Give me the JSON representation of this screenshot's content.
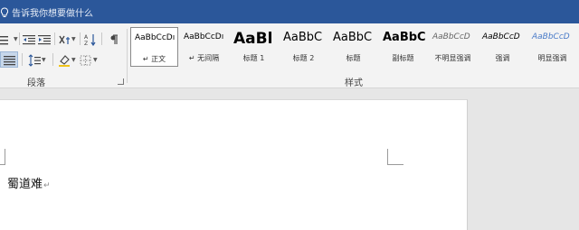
{
  "titlebar": {
    "tell_me": "告诉我你想要做什么",
    "lightbulb_icon": "lightbulb-icon",
    "bg_color": "#2b579a"
  },
  "ribbon": {
    "paragraph_group": {
      "label": "段落",
      "icons": [
        "bullets-icon",
        "decrease-indent-icon",
        "increase-indent-icon",
        "chinese-layout-icon",
        "sort-icon",
        "show-marks-icon",
        "align-justify-icon",
        "line-spacing-icon",
        "shading-icon",
        "borders-icon",
        "dialog-launcher-icon"
      ]
    },
    "styles_group": {
      "label": "样式",
      "items": [
        {
          "sample": "AaBbCcDı",
          "name": "↵ 正文",
          "selected": true
        },
        {
          "sample": "AaBbCcDı",
          "name": "↵ 无间隔",
          "selected": false
        },
        {
          "sample": "AaBl",
          "name": "标题 1",
          "selected": false
        },
        {
          "sample": "AaBbC",
          "name": "标题 2",
          "selected": false
        },
        {
          "sample": "AaBbC",
          "name": "标题",
          "selected": false
        },
        {
          "sample": "AaBbC",
          "name": "副标题",
          "selected": false
        },
        {
          "sample": "AaBbCcD",
          "name": "不明显强调",
          "selected": false
        },
        {
          "sample": "AaBbCcD",
          "name": "强调",
          "selected": false
        },
        {
          "sample": "AaBbCcD",
          "name": "明显强调",
          "selected": false
        }
      ]
    }
  },
  "document": {
    "body_text": "蜀道难",
    "paragraph_mark": "↵"
  }
}
